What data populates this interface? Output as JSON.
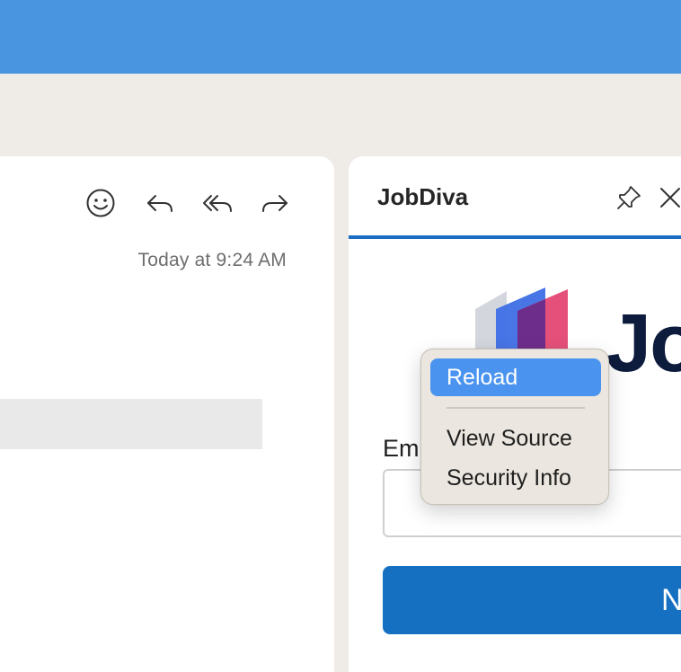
{
  "message": {
    "timestamp": "Today at 9:24 AM",
    "toolbar": {
      "emoji_icon": "smiley-icon",
      "reply_icon": "reply-icon",
      "reply_all_icon": "reply-all-icon",
      "forward_icon": "forward-icon"
    }
  },
  "addin": {
    "title": "JobDiva",
    "logo_text": "Jo",
    "email_label": "Em",
    "email_value": "",
    "next_label": "N",
    "pin_icon": "pin-icon",
    "close_icon": "close-icon"
  },
  "context_menu": {
    "items": [
      {
        "label": "Reload",
        "active": true
      },
      {
        "label": "View Source",
        "active": false
      },
      {
        "label": "Security Info",
        "active": false
      }
    ]
  },
  "colors": {
    "top_bar": "#4a95df",
    "background": "#efebe6",
    "accent": "#1670c2",
    "menu_highlight": "#4a94f0"
  }
}
